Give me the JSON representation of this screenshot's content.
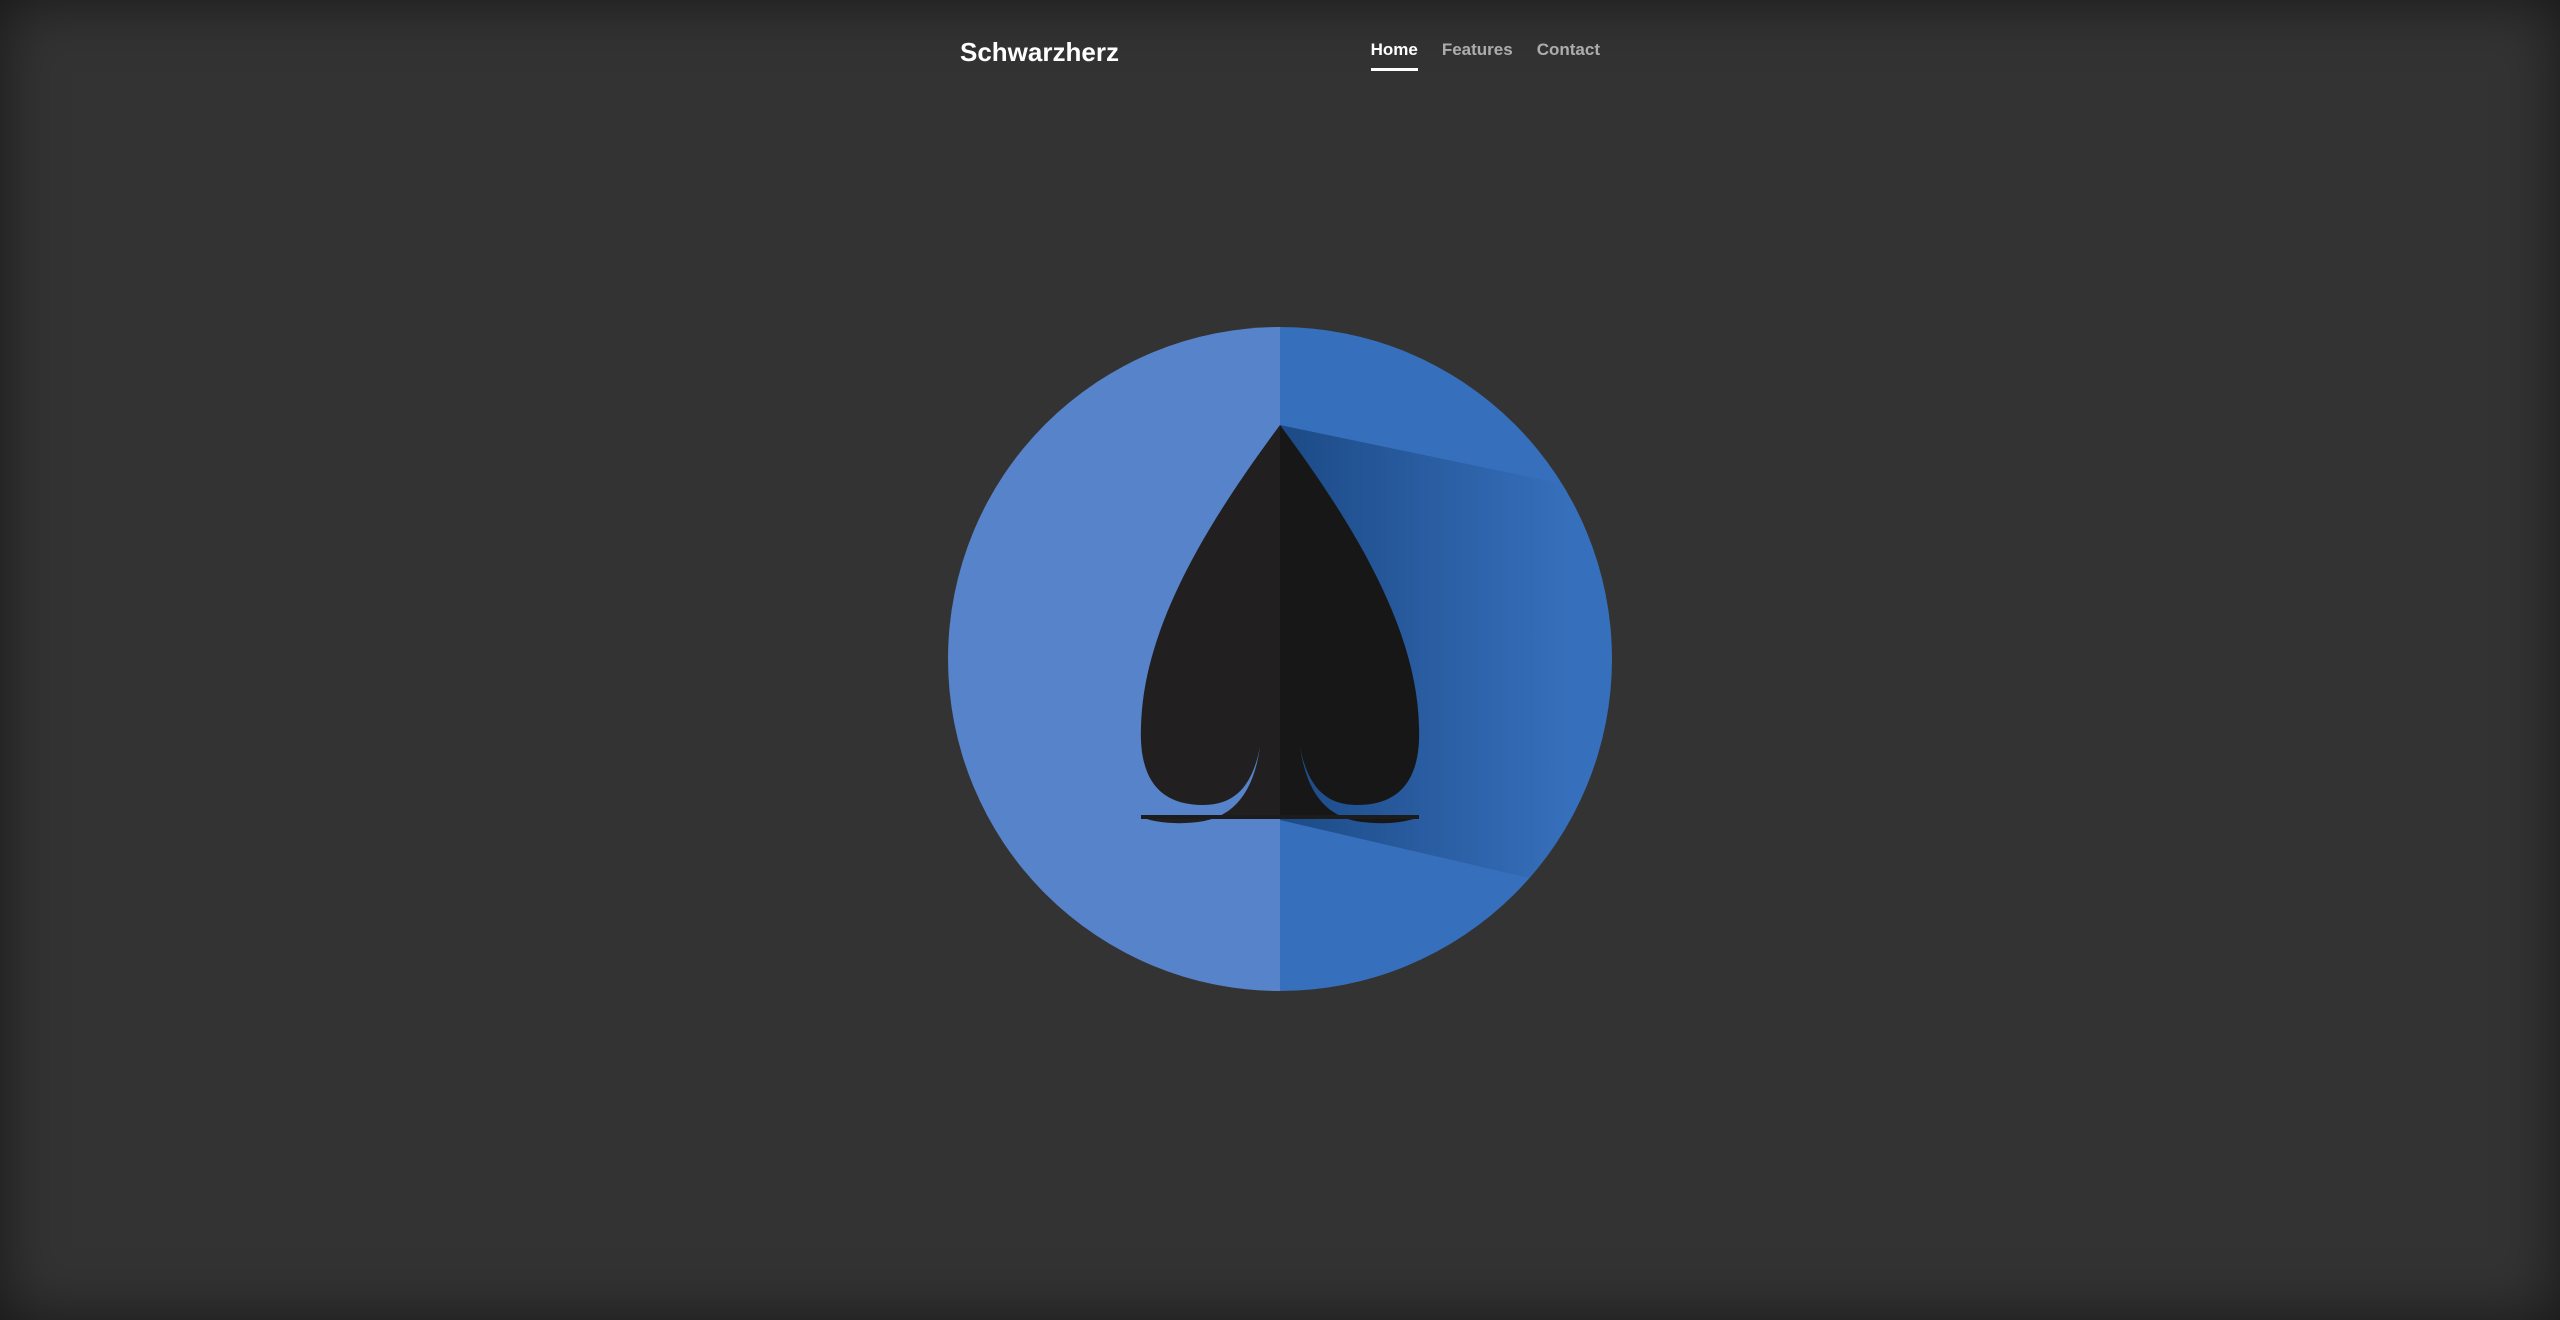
{
  "masthead": {
    "brand": "Schwarzherz",
    "nav": [
      {
        "label": "Home",
        "active": true
      },
      {
        "label": "Features",
        "active": false
      },
      {
        "label": "Contact",
        "active": false
      }
    ]
  },
  "logo": {
    "icon": "spade-icon",
    "colors": {
      "circle_left": "#5683c9",
      "circle_right": "#366fbb",
      "spade_left": "#221f20",
      "spade_right": "#171717",
      "shadow_start": "#1c4a86"
    }
  }
}
